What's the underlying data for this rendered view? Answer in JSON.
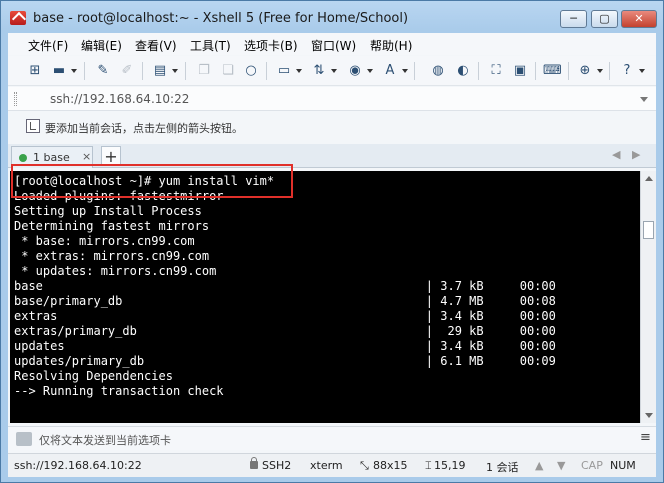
{
  "window": {
    "title": "base - root@localhost:~ - Xshell 5 (Free for Home/School)",
    "buttons": {
      "minimize": "─",
      "maximize": "▢",
      "close": "✕"
    }
  },
  "menu": [
    "文件(F)",
    "编辑(E)",
    "查看(V)",
    "工具(T)",
    "选项卡(B)",
    "窗口(W)",
    "帮助(H)"
  ],
  "toolbar": {
    "icons": [
      "new-session-icon",
      "open-folder-icon",
      "reconnect-icon",
      "disconnect-icon",
      "properties-icon",
      "copy-icon",
      "paste-icon",
      "find-icon",
      "print-icon",
      "transfer-icon",
      "globe-icon",
      "font-icon",
      "xftp-icon",
      "script-icon",
      "fullscreen-icon",
      "lock-icon",
      "keyboard-icon",
      "add-icon",
      "help-icon"
    ]
  },
  "address": {
    "value": "ssh://192.168.64.10:22"
  },
  "hint": {
    "text": "要添加当前会话，点击左侧的箭头按钮。"
  },
  "tabs": [
    {
      "label": "1 base",
      "close": "×"
    }
  ],
  "tab_add": "+",
  "tab_nav": {
    "prev": "◀",
    "next": "▶"
  },
  "terminal": {
    "lines": [
      "[root@localhost ~]# yum install vim*",
      "Loaded plugins: fastestmirror",
      "Setting up Install Process",
      "Determining fastest mirrors",
      " * base: mirrors.cn99.com",
      " * extras: mirrors.cn99.com",
      " * updates: mirrors.cn99.com",
      "base                                                     | 3.7 kB     00:00",
      "base/primary_db                                          | 4.7 MB     00:08",
      "extras                                                   | 3.4 kB     00:00",
      "extras/primary_db                                        |  29 kB     00:00",
      "updates                                                  | 3.4 kB     00:00",
      "updates/primary_db                                       | 6.1 MB     00:09",
      "Resolving Dependencies",
      "--> Running transaction check"
    ]
  },
  "sendbar": {
    "text": "仅将文本发送到当前选项卡",
    "menu": "≡"
  },
  "status": {
    "address": "ssh://192.168.64.10:22",
    "protocol": "SSH2",
    "terminal_type": "xterm",
    "size": "88x15",
    "cursor": "15,19",
    "sessions": "1 会话",
    "caps": "CAP",
    "num": "NUM"
  },
  "colors": {
    "terminal_bg": "#000000",
    "terminal_fg": "#ffffff",
    "highlight": "#e0302a",
    "titlebar": "#a9cbea"
  }
}
